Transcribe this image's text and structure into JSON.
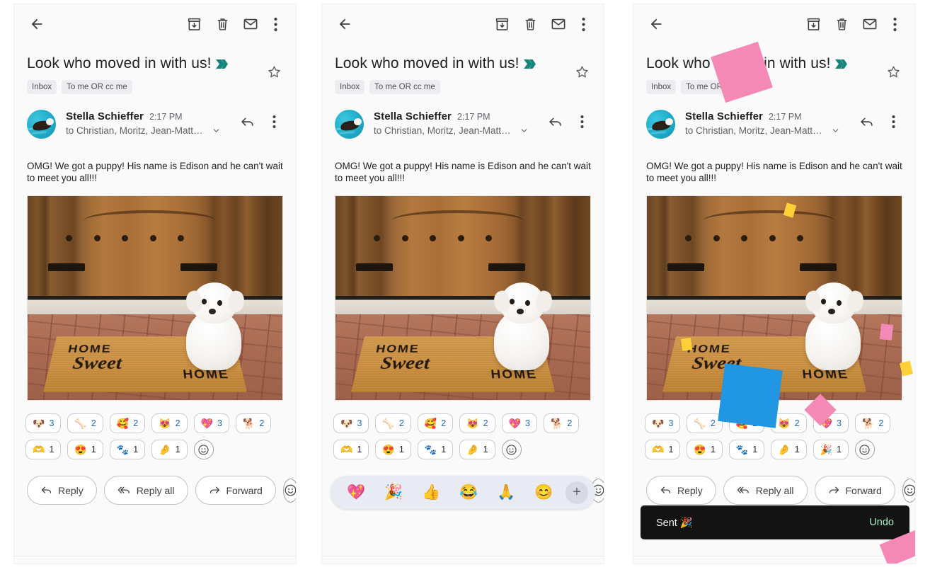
{
  "toolbar": {
    "back_icon": "back-arrow-icon",
    "archive_icon": "archive-icon",
    "delete_icon": "delete-trash-icon",
    "unread_icon": "mark-unread-envelope-icon",
    "more_icon": "more-vertical-icon"
  },
  "email": {
    "subject": "Look who moved in with us!",
    "importance_marker": "double-chevron-importance-icon",
    "labels": [
      "Inbox",
      "To me OR cc me"
    ],
    "star_icon": "star-outline-icon",
    "sender_name": "Stella Schieffer",
    "time": "2:17 PM",
    "recipients": "to Christian, Moritz, Jean-Matthi...",
    "body_text": "OMG! We got a puppy! His name is Edison and he can't wait to meet you all!!!",
    "attachment": {
      "alt": "White puppy sitting on a HOME SWEET HOME doormat in front of a wooden door",
      "mat_line1": "HOME",
      "mat_script": "Sweet",
      "mat_line2": "HOME"
    }
  },
  "reactions_base": {
    "row1": [
      {
        "emoji": "🐶",
        "name": "dog-face-reaction",
        "count": "3"
      },
      {
        "emoji": "🦴",
        "name": "bone-reaction",
        "count": "2"
      },
      {
        "emoji": "🥰",
        "name": "smiling-face-with-hearts-reaction",
        "count": "2"
      },
      {
        "emoji": "😻",
        "name": "smiling-cat-heart-eyes-reaction",
        "count": "2"
      },
      {
        "emoji": "💖",
        "name": "sparkling-heart-reaction",
        "count": "3"
      },
      {
        "emoji": "🐕",
        "name": "dog-reaction",
        "count": "2"
      }
    ],
    "row2": [
      {
        "emoji": "🫶",
        "name": "heart-hands-reaction",
        "count": "1"
      },
      {
        "emoji": "😍",
        "name": "heart-eyes-reaction",
        "count": "1"
      },
      {
        "emoji": "🐾",
        "name": "paw-prints-reaction",
        "count": "1"
      },
      {
        "emoji": "🤌",
        "name": "pinched-fingers-reaction",
        "count": "1"
      }
    ],
    "add_label": "☺"
  },
  "reactions_sent": {
    "row2_extra": {
      "emoji": "🎉",
      "name": "party-popper-reaction",
      "count": "1"
    }
  },
  "emoji_picker": {
    "items": [
      {
        "emoji": "💖",
        "name": "sparkling-heart-emoji-option"
      },
      {
        "emoji": "🎉",
        "name": "party-popper-emoji-option"
      },
      {
        "emoji": "👍",
        "name": "thumbs-up-emoji-option"
      },
      {
        "emoji": "😂",
        "name": "face-with-tears-of-joy-emoji-option"
      },
      {
        "emoji": "🙏",
        "name": "folded-hands-emoji-option"
      },
      {
        "emoji": "😊",
        "name": "smiling-face-emoji-option"
      }
    ],
    "more_label": "+"
  },
  "actions": {
    "reply": "Reply",
    "reply_all": "Reply all",
    "forward": "Forward",
    "emoji_label": "☺"
  },
  "toast": {
    "message": "Sent 🎉",
    "undo": "Undo"
  },
  "colors": {
    "accent_teal": "#14857c",
    "link_blue": "#1b64c4",
    "toast_bg": "#131314",
    "toast_undo": "#a8f0c6",
    "confetti_pink": "#f489b5",
    "confetti_blue": "#2196e3",
    "confetti_yellow": "#fdd036",
    "chip_bg": "#ececf1",
    "picker_bg": "#e8eaf4"
  }
}
